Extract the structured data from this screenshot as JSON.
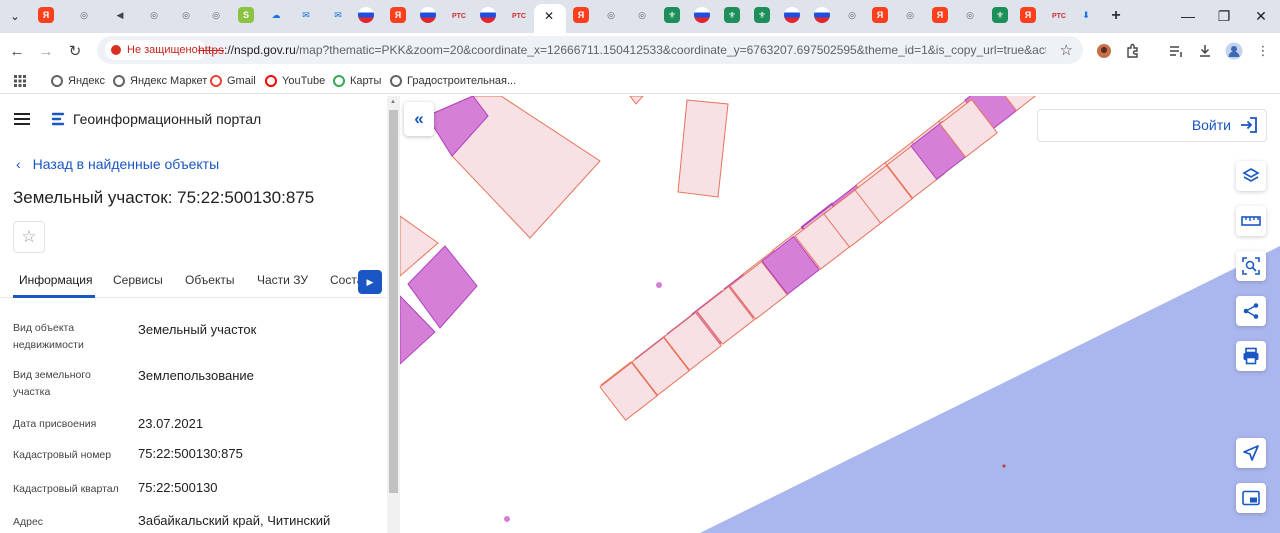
{
  "browser": {
    "tabs": [
      {
        "icon": "tab-favicon-yandex"
      },
      {
        "icon": "tab-favicon-globe"
      },
      {
        "icon": "tab-favicon-audio"
      },
      {
        "icon": "tab-favicon-globe"
      },
      {
        "icon": "tab-favicon-globe"
      },
      {
        "icon": "tab-favicon-globe"
      },
      {
        "icon": "tab-favicon-gosuslugi"
      },
      {
        "icon": "tab-favicon-cloud"
      },
      {
        "icon": "tab-favicon-mail"
      },
      {
        "icon": "tab-favicon-mail"
      },
      {
        "icon": "tab-favicon-flag"
      },
      {
        "icon": "tab-favicon-yandex"
      },
      {
        "icon": "tab-favicon-flag"
      },
      {
        "label": "РТС"
      },
      {
        "icon": "tab-favicon-flag"
      },
      {
        "label": "РТС"
      }
    ],
    "active_tab_close": "✕",
    "tabs_right": [
      {
        "icon": "tab-favicon-yandex"
      },
      {
        "icon": "tab-favicon-globe"
      },
      {
        "icon": "tab-favicon-globe"
      },
      {
        "icon": "tab-favicon-emblem"
      },
      {
        "icon": "tab-favicon-flag"
      },
      {
        "icon": "tab-favicon-emblem"
      },
      {
        "icon": "tab-favicon-emblem"
      },
      {
        "icon": "tab-favicon-flag"
      },
      {
        "icon": "tab-favicon-flag"
      },
      {
        "icon": "tab-favicon-globe"
      },
      {
        "icon": "tab-favicon-yandex"
      },
      {
        "icon": "tab-favicon-globe"
      },
      {
        "icon": "tab-favicon-yandex"
      },
      {
        "icon": "tab-favicon-globe"
      },
      {
        "icon": "tab-favicon-emblem"
      },
      {
        "icon": "tab-favicon-yandex"
      },
      {
        "label": "РТС"
      },
      {
        "icon": "tab-favicon-download"
      }
    ],
    "new_tab": "+",
    "window": {
      "minimize": "—",
      "restore": "❐",
      "close": "✕"
    },
    "security_label": "Не защищено",
    "url_scheme": "https",
    "url_domain": "://nspd.gov.ru",
    "url_rest": "/map?thematic=PKK&zoom=20&coordinate_x=12666711.150412533&coordinate_y=6763207.697502595&theme_id=1&is_copy_url=true&active_layer...",
    "bookmarks": [
      {
        "label": "Яндекс",
        "color": "#5f6368"
      },
      {
        "label": "Яндекс Маркет",
        "color": "#5f6368"
      },
      {
        "label": "Gmail",
        "color": "#ea4335"
      },
      {
        "label": "YouTube",
        "color": "#ff0000"
      },
      {
        "label": "Карты",
        "color": "#34a853"
      },
      {
        "label": "Градостроительная...",
        "color": "#5f6368"
      }
    ]
  },
  "portal": {
    "title": "Геоинформационный портал",
    "back_link": "Назад в найденные объекты",
    "object_title": "Земельный участок: 75:22:500130:875",
    "tabs": [
      "Информация",
      "Сервисы",
      "Объекты",
      "Части ЗУ",
      "Соста"
    ],
    "properties": [
      {
        "label": "Вид объекта недвижимости",
        "value": "Земельный участок"
      },
      {
        "label": "Вид земельного участка",
        "value": "Землепользование"
      },
      {
        "label": "Дата присвоения",
        "value": "23.07.2021"
      },
      {
        "label": "Кадастровый номер",
        "value": "75:22:500130:875"
      },
      {
        "label": "Кадастровый квартал",
        "value": "75:22:500130"
      },
      {
        "label": "Адрес",
        "value": "Забайкальский край, Читинский"
      }
    ]
  },
  "map": {
    "login_label": "Войти",
    "tools": [
      "layers-icon",
      "ruler-icon",
      "select-area-icon",
      "share-icon",
      "print-icon",
      "locate-icon",
      "minimap-icon"
    ],
    "colors": {
      "parcel_fill": "#f7e1e4",
      "parcel_stroke": "#e8735a",
      "highlight_fill": "#d57fd6",
      "highlight_stroke": "#b23fbf",
      "selected_fill": "#e3bfe0",
      "water": "#aab6ee",
      "accent": "#1a56c4"
    }
  }
}
